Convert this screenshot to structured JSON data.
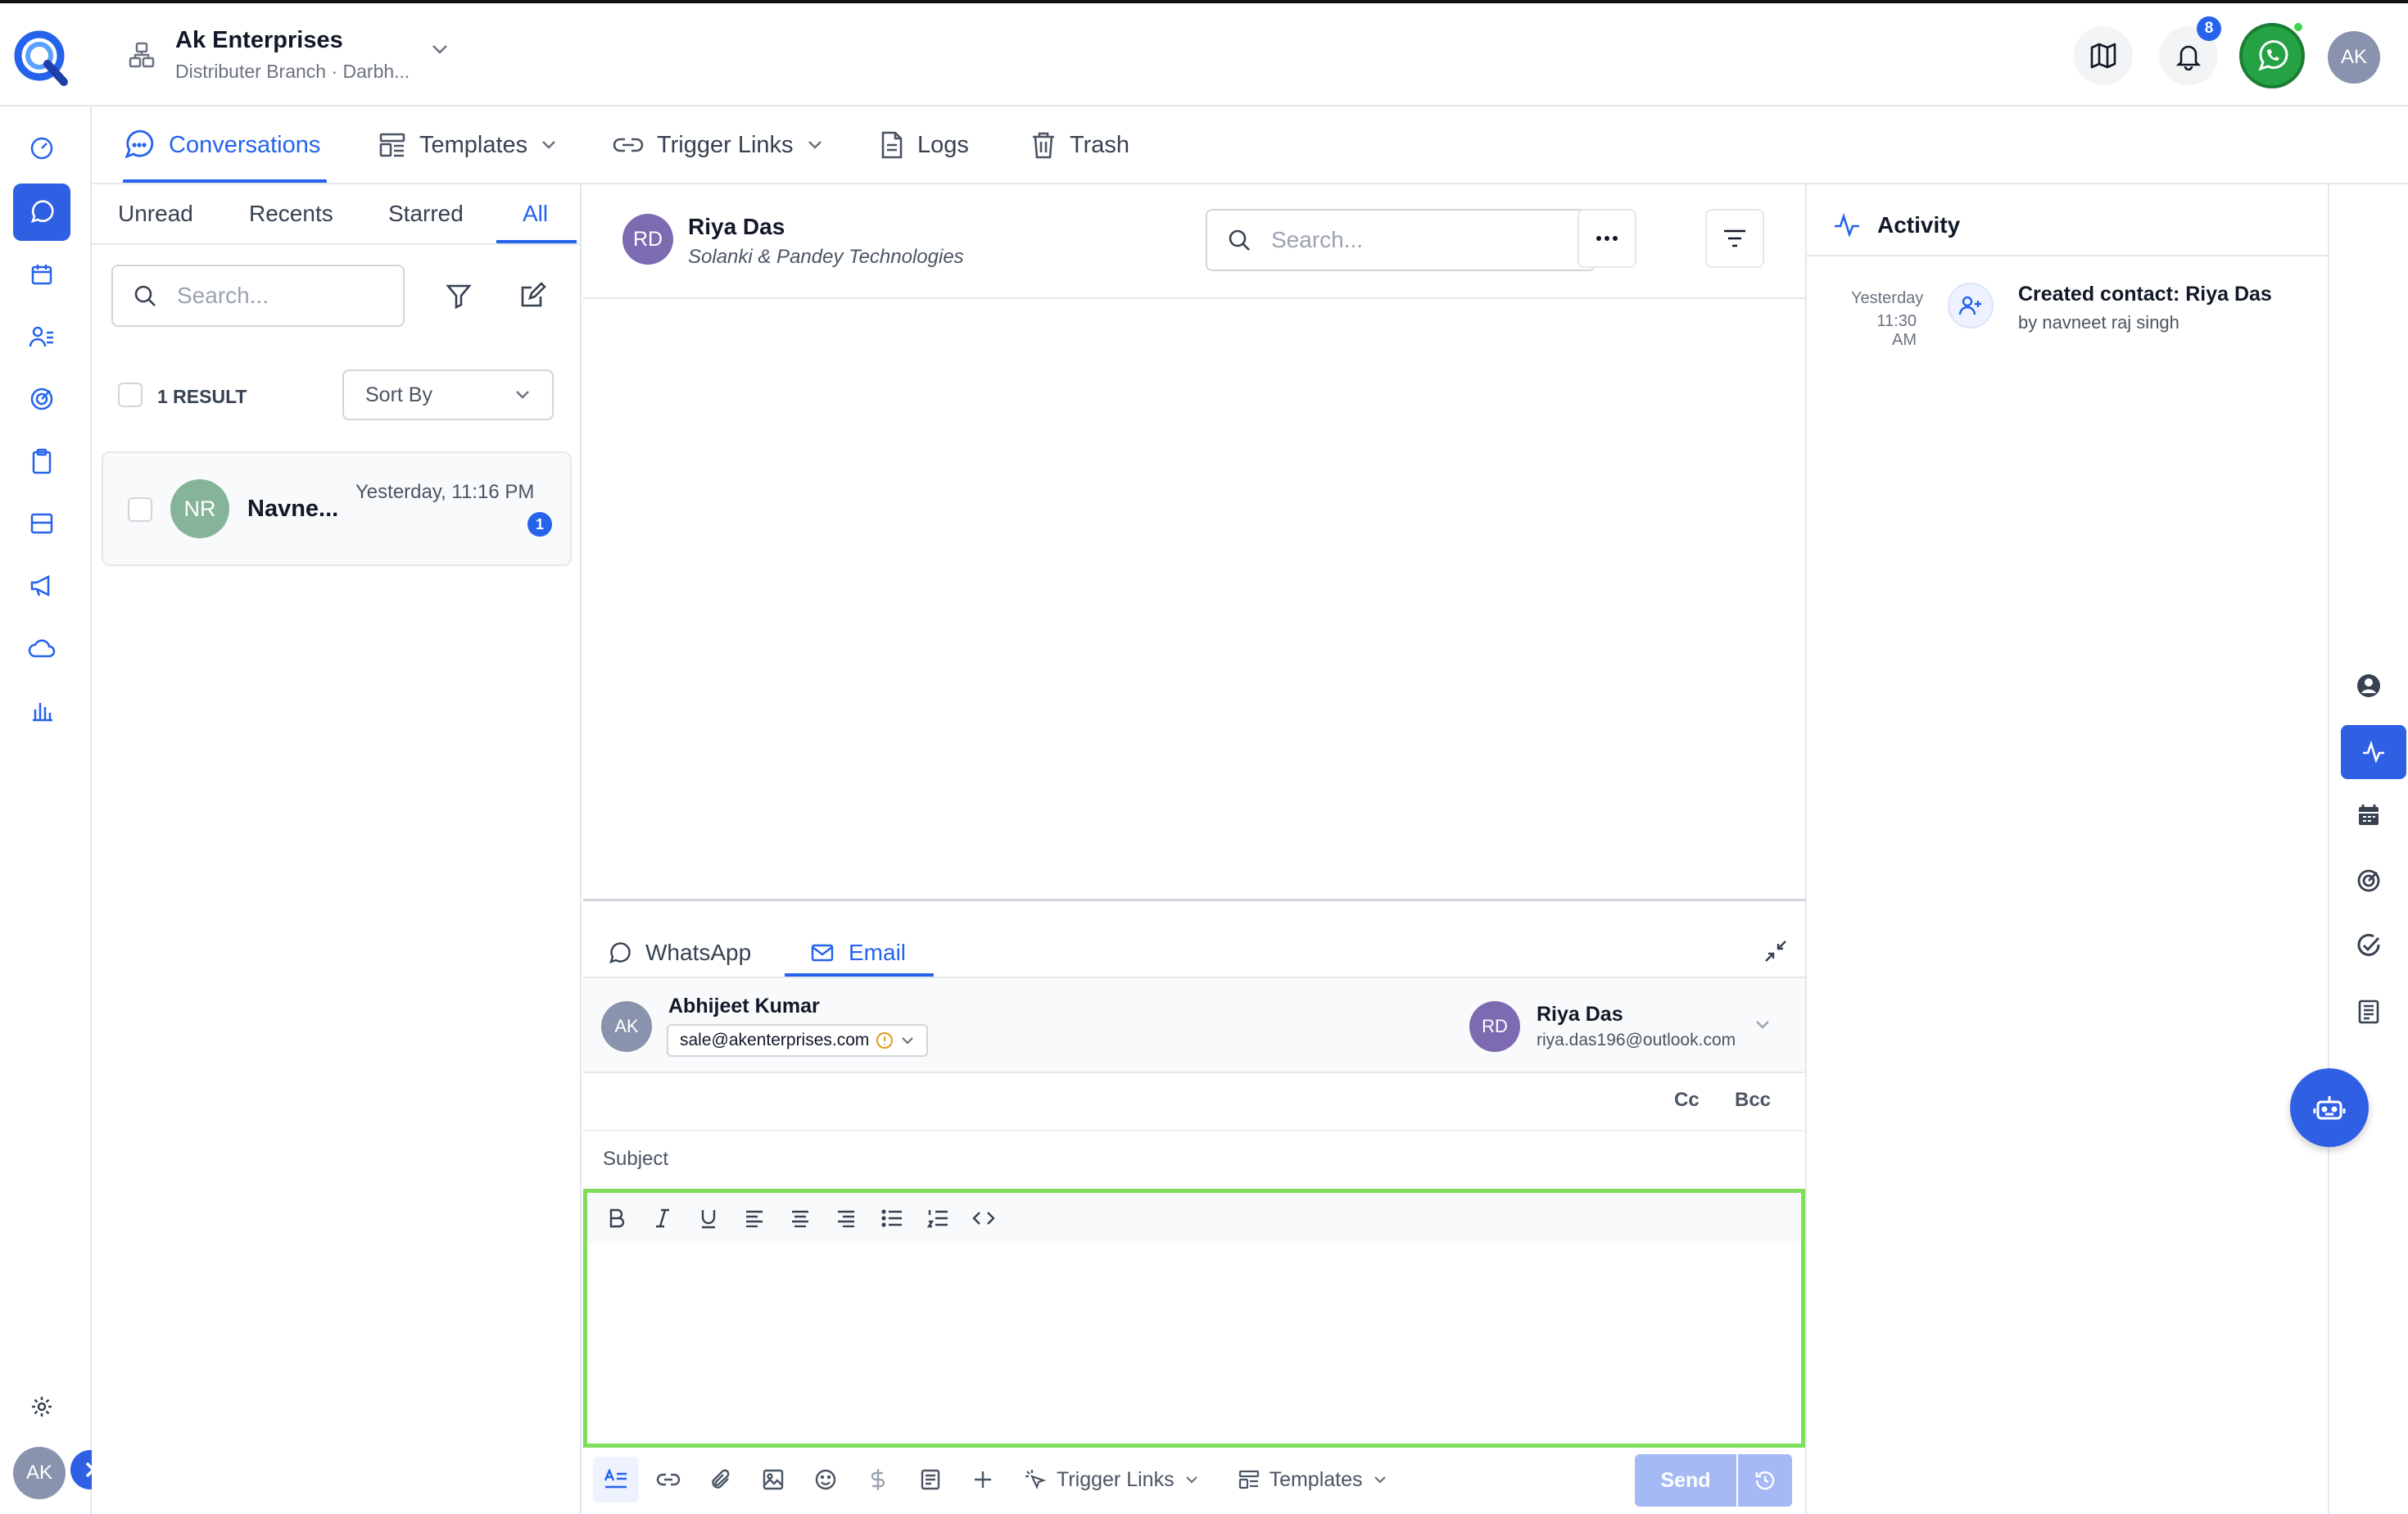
{
  "brand": {
    "company": "Ak Enterprises",
    "branch": "Distributer Branch · Darbh..."
  },
  "header": {
    "notification_count": "8",
    "user_initials": "AK"
  },
  "nav_tabs": [
    {
      "label": "Conversations",
      "icon": "chat-bubble-icon",
      "active": true
    },
    {
      "label": "Templates",
      "icon": "template-icon"
    },
    {
      "label": "Trigger Links",
      "icon": "link-icon"
    },
    {
      "label": "Logs",
      "icon": "document-icon"
    },
    {
      "label": "Trash",
      "icon": "trash-icon"
    }
  ],
  "list": {
    "tabs": [
      "Unread",
      "Recents",
      "Starred",
      "All"
    ],
    "active_tab": "All",
    "search_placeholder": "Search...",
    "result_count": "1 RESULT",
    "sort_label": "Sort By",
    "items": [
      {
        "initials": "NR",
        "name": "Navne...",
        "time": "Yesterday, 11:16 PM",
        "unread": "1"
      }
    ]
  },
  "conversation": {
    "contact_initials": "RD",
    "contact_name": "Riya Das",
    "company": "Solanki & Pandey Technologies",
    "search_placeholder": "Search..."
  },
  "composer": {
    "channels": [
      "WhatsApp",
      "Email"
    ],
    "active_channel": "Email",
    "from_initials": "AK",
    "from_name": "Abhijeet Kumar",
    "from_email": "sale@akenterprises.com",
    "to_initials": "RD",
    "to_name": "Riya Das",
    "to_email": "riya.das196@outlook.com",
    "cc_label": "Cc",
    "bcc_label": "Bcc",
    "subject_placeholder": "Subject",
    "trigger_links_label": "Trigger Links",
    "templates_label": "Templates",
    "send_label": "Send"
  },
  "activity": {
    "title": "Activity",
    "entries": [
      {
        "date": "Yesterday",
        "time": "11:30 AM",
        "title": "Created contact: Riya Das",
        "by": "by navneet raj singh"
      }
    ]
  },
  "footer": {
    "user_initials": "AK"
  },
  "colors": {
    "accent": "#2563eb",
    "accent_bg": "#2f5fe3",
    "whatsapp": "#25a244",
    "editor_outline": "#7ee05a",
    "avatar_nr": "#86b49a",
    "avatar_rd": "#7c6bb0",
    "avatar_ak": "#8a93ad"
  }
}
